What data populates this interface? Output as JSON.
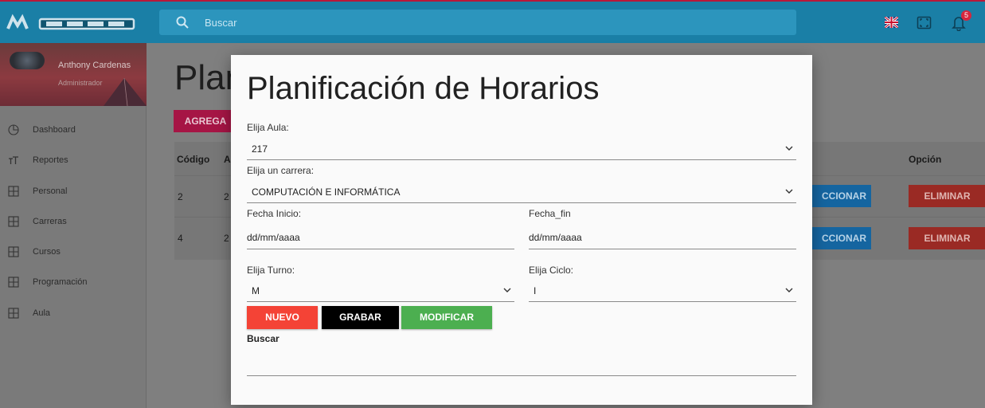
{
  "topbar": {
    "search_placeholder": "Buscar",
    "notification_count": "5",
    "accent_color": "#1a7fa6"
  },
  "sidebar": {
    "user_name": "Anthony Cardenas",
    "user_role": "Administrador",
    "items": [
      {
        "label": "Dashboard",
        "icon": "pie-chart-icon"
      },
      {
        "label": "Reportes",
        "icon": "text-size-icon"
      },
      {
        "label": "Personal",
        "icon": "grid-icon"
      },
      {
        "label": "Carreras",
        "icon": "grid-icon"
      },
      {
        "label": "Cursos",
        "icon": "grid-icon"
      },
      {
        "label": "Programación",
        "icon": "grid-icon"
      },
      {
        "label": "Aula",
        "icon": "grid-icon"
      }
    ]
  },
  "background": {
    "title": "Plan",
    "add_button": "AGREGA",
    "col_codigo": "Código",
    "col_a": "A",
    "col_opcion": "Opción",
    "rows": [
      {
        "codigo": "2",
        "aula": "2",
        "select_label": "CCIONAR",
        "delete_label": "ELIMINAR"
      },
      {
        "codigo": "4",
        "aula": "2",
        "select_label": "CCIONAR",
        "delete_label": "ELIMINAR"
      }
    ]
  },
  "modal": {
    "title": "Planificación de Horarios",
    "aula": {
      "label": "Elija Aula:",
      "value": "217"
    },
    "carrera": {
      "label": "Elija un carrera:",
      "value": "COMPUTACIÓN E INFORMÁTICA"
    },
    "fecha_inicio": {
      "label": "Fecha Inicio:",
      "value": "dd/mm/aaaa"
    },
    "fecha_fin": {
      "label": "Fecha_fin",
      "value": "dd/mm/aaaa"
    },
    "turno": {
      "label": "Elija Turno:",
      "value": "M"
    },
    "ciclo": {
      "label": "Elija Ciclo:",
      "value": "I"
    },
    "buttons": {
      "nuevo": "NUEVO",
      "grabar": "GRABAR",
      "modificar": "MODIFICAR"
    },
    "button_colors": {
      "nuevo": "#f44336",
      "grabar": "#000000",
      "modificar": "#4caf50"
    },
    "search_label": "Buscar"
  }
}
